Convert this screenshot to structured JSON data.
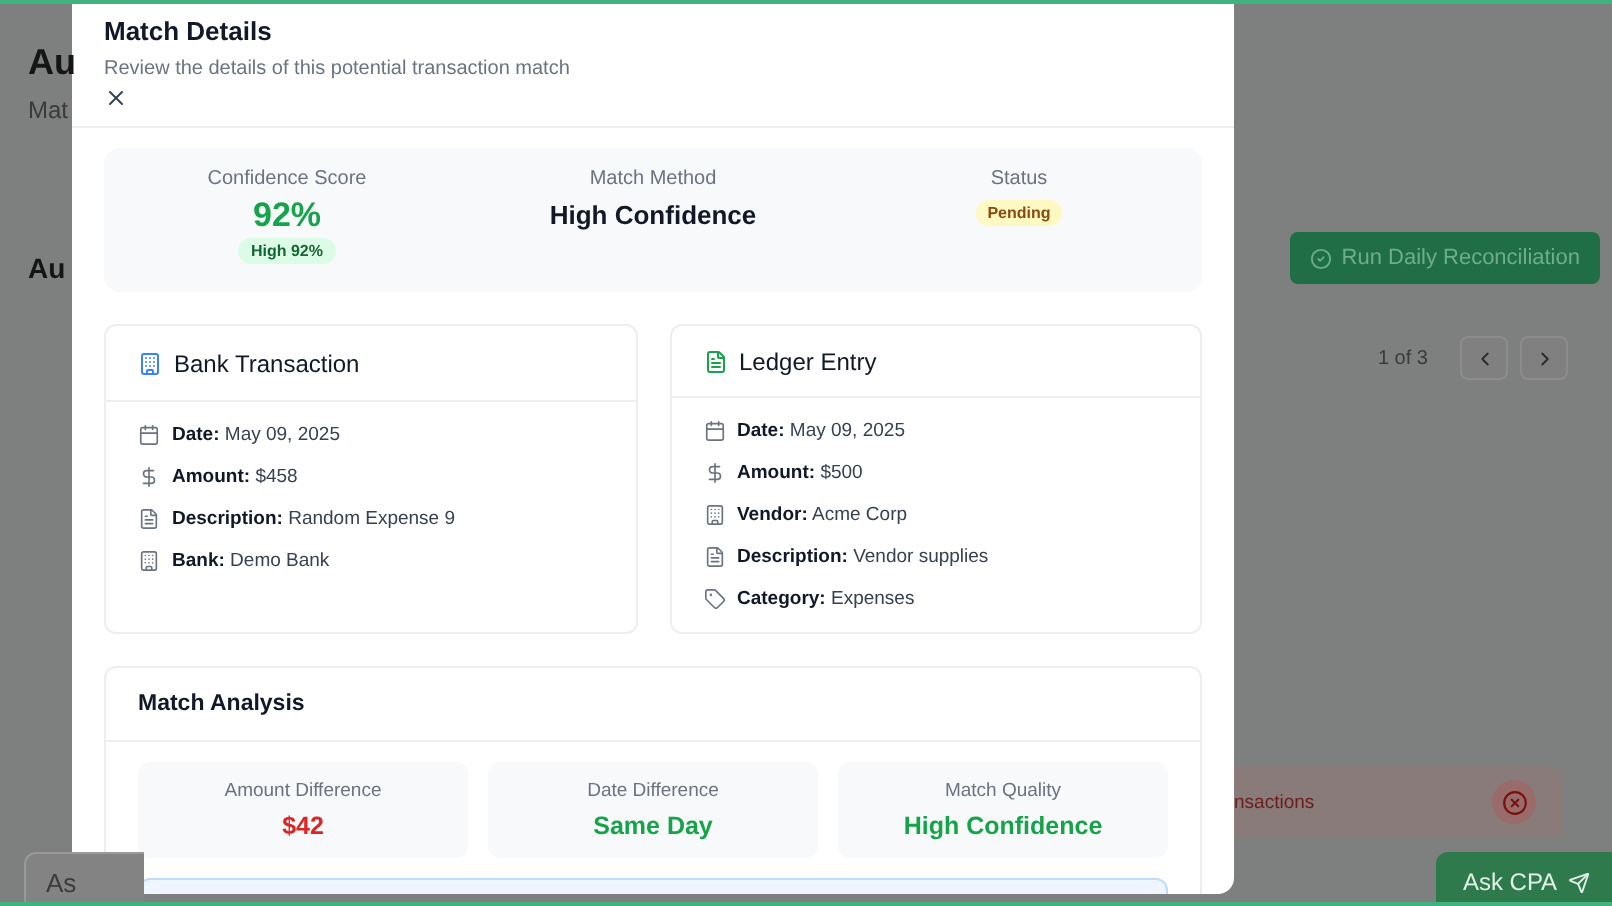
{
  "background": {
    "title": "Au",
    "subtitle": "Mat",
    "section_title": "Au",
    "run_button": "Run Daily Reconciliation",
    "pager": "1 of 3",
    "alert": "nsactions",
    "chat_placeholder": "As",
    "ask_button": "Ask CPA"
  },
  "modal": {
    "title": "Match Details",
    "subtitle": "Review the details of this potential transaction match",
    "summary": [
      {
        "kind": "score",
        "label": "Confidence Score",
        "value": "92%",
        "badge": "High 92%"
      },
      {
        "kind": "text",
        "label": "Match Method",
        "value": "High Confidence"
      },
      {
        "kind": "status",
        "label": "Status",
        "value": "Pending"
      }
    ],
    "cards": [
      {
        "kind": "bank",
        "title": "Bank Transaction",
        "fields": [
          {
            "kind": "date",
            "label": "Date:",
            "value": "May 09, 2025"
          },
          {
            "kind": "amount",
            "label": "Amount:",
            "value": "$458"
          },
          {
            "kind": "description",
            "label": "Description:",
            "value": "Random Expense 9"
          },
          {
            "kind": "bank",
            "label": "Bank:",
            "value": "Demo Bank"
          }
        ]
      },
      {
        "kind": "ledger",
        "title": "Ledger Entry",
        "fields": [
          {
            "kind": "date",
            "label": "Date:",
            "value": "May 09, 2025"
          },
          {
            "kind": "amount",
            "label": "Amount:",
            "value": "$500"
          },
          {
            "kind": "bank",
            "label": "Vendor:",
            "value": "Acme Corp"
          },
          {
            "kind": "description",
            "label": "Description:",
            "value": "Vendor supplies"
          },
          {
            "kind": "category",
            "label": "Category:",
            "value": "Expenses"
          }
        ]
      }
    ],
    "analysis": {
      "title": "Match Analysis",
      "metrics": [
        {
          "label": "Amount Difference",
          "value": "$42",
          "color": "#dc2626"
        },
        {
          "label": "Date Difference",
          "value": "Same Day",
          "color": "#16a34a"
        },
        {
          "label": "Match Quality",
          "value": "High Confidence",
          "color": "#16a34a"
        }
      ]
    }
  }
}
